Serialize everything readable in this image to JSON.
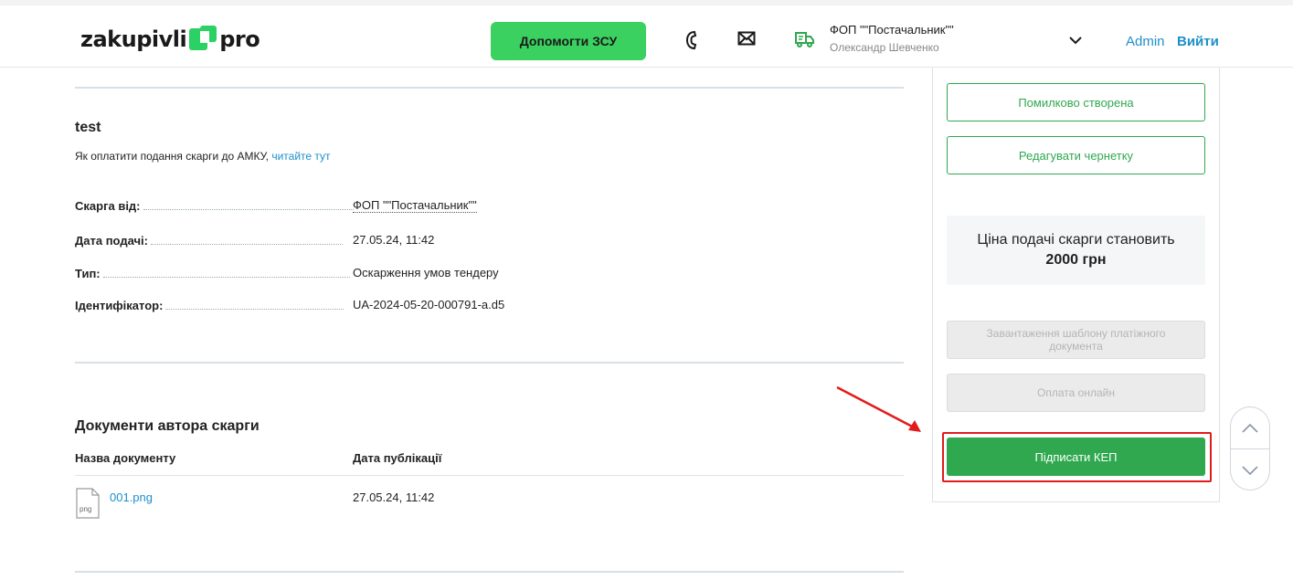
{
  "header": {
    "logo_left": "zakupivli",
    "logo_right": "pro",
    "help_button": "Допомогти ЗСУ",
    "organization": "ФОП \"\"Постачальник\"\"",
    "user": "Олександр Шевченко",
    "admin_link": "Admin",
    "logout_link": "Вийти"
  },
  "complaint": {
    "title": "test",
    "pay_hint": "Як оплатити подання скарги до АМКУ, ",
    "pay_hint_link": "читайте тут",
    "details": [
      {
        "label": "Скарга від:",
        "value": "ФОП \"\"Постачальник\"\""
      },
      {
        "label": "Дата подачі:",
        "value": "27.05.24, 11:42"
      },
      {
        "label": "Тип:",
        "value": "Оскарження умов тендеру"
      },
      {
        "label": "Ідентифікатор:",
        "value": "UA-2024-05-20-000791-a.d5"
      }
    ]
  },
  "documents": {
    "title": "Документи автора скарги",
    "col_name": "Назва документу",
    "col_date": "Дата публікації",
    "rows": [
      {
        "file_type": "png",
        "name": "001.png",
        "date": "27.05.24, 11:42"
      }
    ]
  },
  "sidebar": {
    "mistaken_button": "Помилково створена",
    "edit_draft_button": "Редагувати чернетку",
    "price_text": "Ціна подачі скарги становить",
    "price_amount": "2000 грн",
    "template_button": "Завантаження шаблону платіжного документа",
    "pay_online_button": "Оплата онлайн",
    "sign_button": "Підписати КЕП"
  },
  "colors": {
    "accent_green": "#2fa84f",
    "help_green": "#3bd160",
    "link_blue": "#1e8fc9",
    "highlight_red": "#e21b1b"
  },
  "icons": [
    "phone-icon",
    "mail-icon",
    "truck-icon",
    "chevron-down-icon",
    "file-png-icon",
    "chevron-up-icon",
    "chevron-down-icon"
  ]
}
